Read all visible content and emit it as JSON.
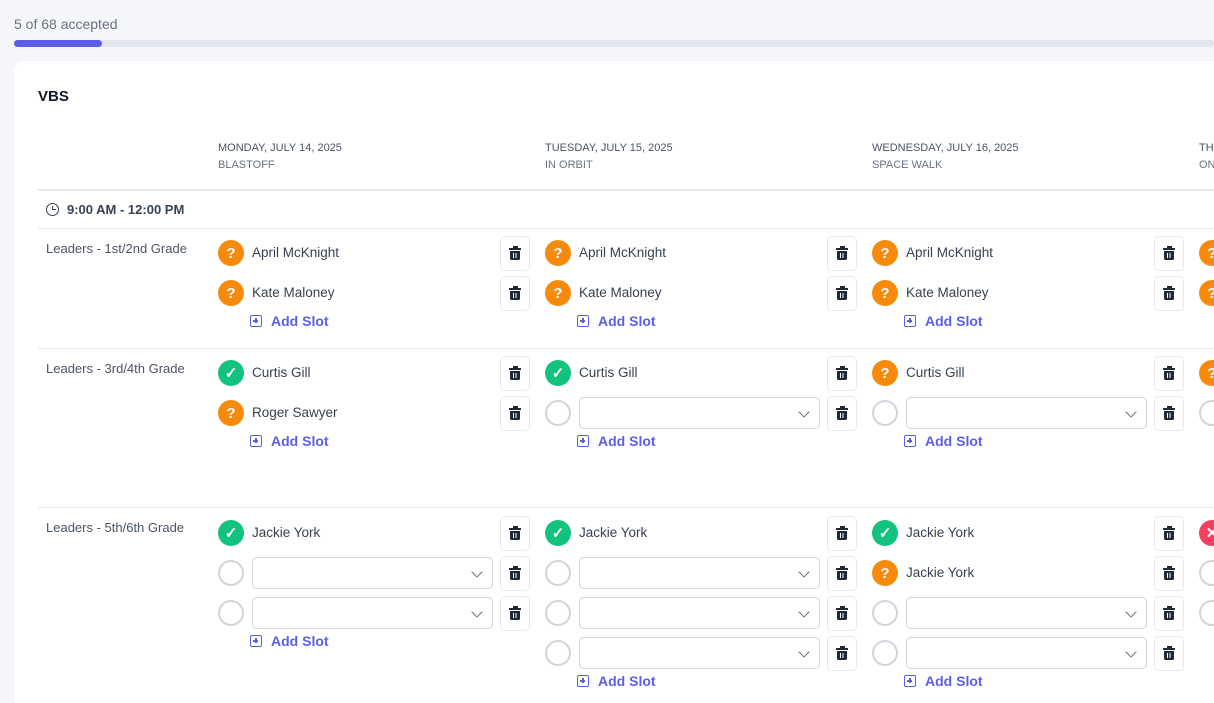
{
  "progress": {
    "label": "5 of 68 accepted",
    "accepted": 5,
    "total": 68
  },
  "colors": {
    "accent": "#5b5fe6",
    "pending": "#f68b0b",
    "accepted": "#13c27d",
    "declined": "#f43f5e"
  },
  "event": {
    "title": "VBS"
  },
  "time_block": "9:00 AM - 12:00 PM",
  "add_slot_label": "Add Slot",
  "days": [
    {
      "date": "MONDAY, JULY 14, 2025",
      "theme": "BLASTOFF"
    },
    {
      "date": "TUESDAY, JULY 15, 2025",
      "theme": "IN ORBIT"
    },
    {
      "date": "WEDNESDAY, JULY 16, 2025",
      "theme": "SPACE WALK"
    },
    {
      "date": "TH",
      "theme": "ON"
    }
  ],
  "roles": [
    {
      "label": "Leaders - 1st/2nd Grade",
      "days": [
        [
          {
            "status": "pending",
            "name": "April McKnight"
          },
          {
            "status": "pending",
            "name": "Kate Maloney"
          }
        ],
        [
          {
            "status": "pending",
            "name": "April McKnight"
          },
          {
            "status": "pending",
            "name": "Kate Maloney"
          }
        ],
        [
          {
            "status": "pending",
            "name": "April McKnight"
          },
          {
            "status": "pending",
            "name": "Kate Maloney"
          }
        ],
        [
          {
            "status": "pending",
            "name": ""
          },
          {
            "status": "pending",
            "name": ""
          }
        ]
      ]
    },
    {
      "label": "Leaders - 3rd/4th Grade",
      "days": [
        [
          {
            "status": "accepted",
            "name": "Curtis Gill"
          },
          {
            "status": "pending",
            "name": "Roger Sawyer"
          }
        ],
        [
          {
            "status": "accepted",
            "name": "Curtis Gill"
          },
          {
            "status": "empty",
            "name": ""
          }
        ],
        [
          {
            "status": "pending",
            "name": "Curtis Gill"
          },
          {
            "status": "empty",
            "name": ""
          }
        ],
        [
          {
            "status": "pending",
            "name": ""
          },
          {
            "status": "empty",
            "name": ""
          }
        ]
      ]
    },
    {
      "label": "Leaders - 5th/6th Grade",
      "days": [
        [
          {
            "status": "accepted",
            "name": "Jackie York"
          },
          {
            "status": "empty",
            "name": ""
          },
          {
            "status": "empty",
            "name": ""
          }
        ],
        [
          {
            "status": "accepted",
            "name": "Jackie York"
          },
          {
            "status": "empty",
            "name": ""
          },
          {
            "status": "empty",
            "name": ""
          },
          {
            "status": "empty",
            "name": ""
          }
        ],
        [
          {
            "status": "accepted",
            "name": "Jackie York"
          },
          {
            "status": "pending",
            "name": "Jackie York"
          },
          {
            "status": "empty",
            "name": ""
          },
          {
            "status": "empty",
            "name": ""
          }
        ],
        [
          {
            "status": "declined",
            "name": ""
          },
          {
            "status": "empty",
            "name": ""
          },
          {
            "status": "empty",
            "name": ""
          }
        ]
      ]
    }
  ]
}
